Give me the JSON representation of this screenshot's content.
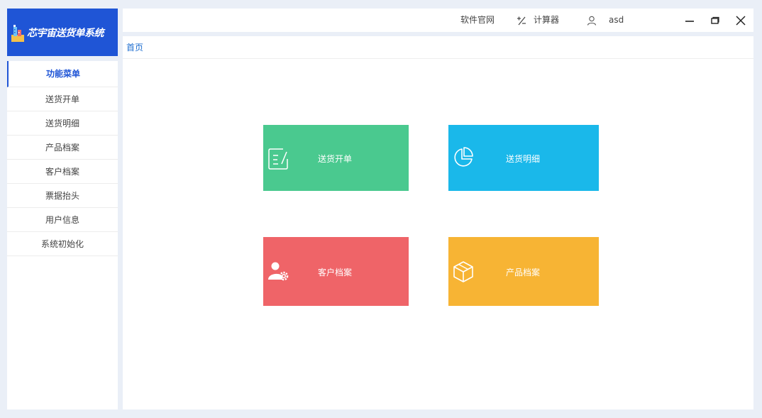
{
  "app": {
    "title": "芯宇宙送货单系统"
  },
  "sidebar": {
    "items": [
      {
        "label": "功能菜单"
      },
      {
        "label": "送货开单"
      },
      {
        "label": "送货明细"
      },
      {
        "label": "产品档案"
      },
      {
        "label": "客户档案"
      },
      {
        "label": "票据抬头"
      },
      {
        "label": "用户信息"
      },
      {
        "label": "系统初始化"
      }
    ]
  },
  "topbar": {
    "website_label": "软件官网",
    "calculator_label": "计算器",
    "calculator_icon": "calculator-icon",
    "user_icon": "user-icon",
    "username": "asd"
  },
  "breadcrumb": {
    "home": "首页"
  },
  "tiles": [
    {
      "label": "送货开单",
      "icon": "edit-document-icon",
      "color": "#4ac98f"
    },
    {
      "label": "送货明细",
      "icon": "pie-chart-icon",
      "color": "#1ab8ea"
    },
    {
      "label": "客户档案",
      "icon": "user-settings-icon",
      "color": "#ef6468"
    },
    {
      "label": "产品档案",
      "icon": "box-icon",
      "color": "#f7b434"
    }
  ]
}
